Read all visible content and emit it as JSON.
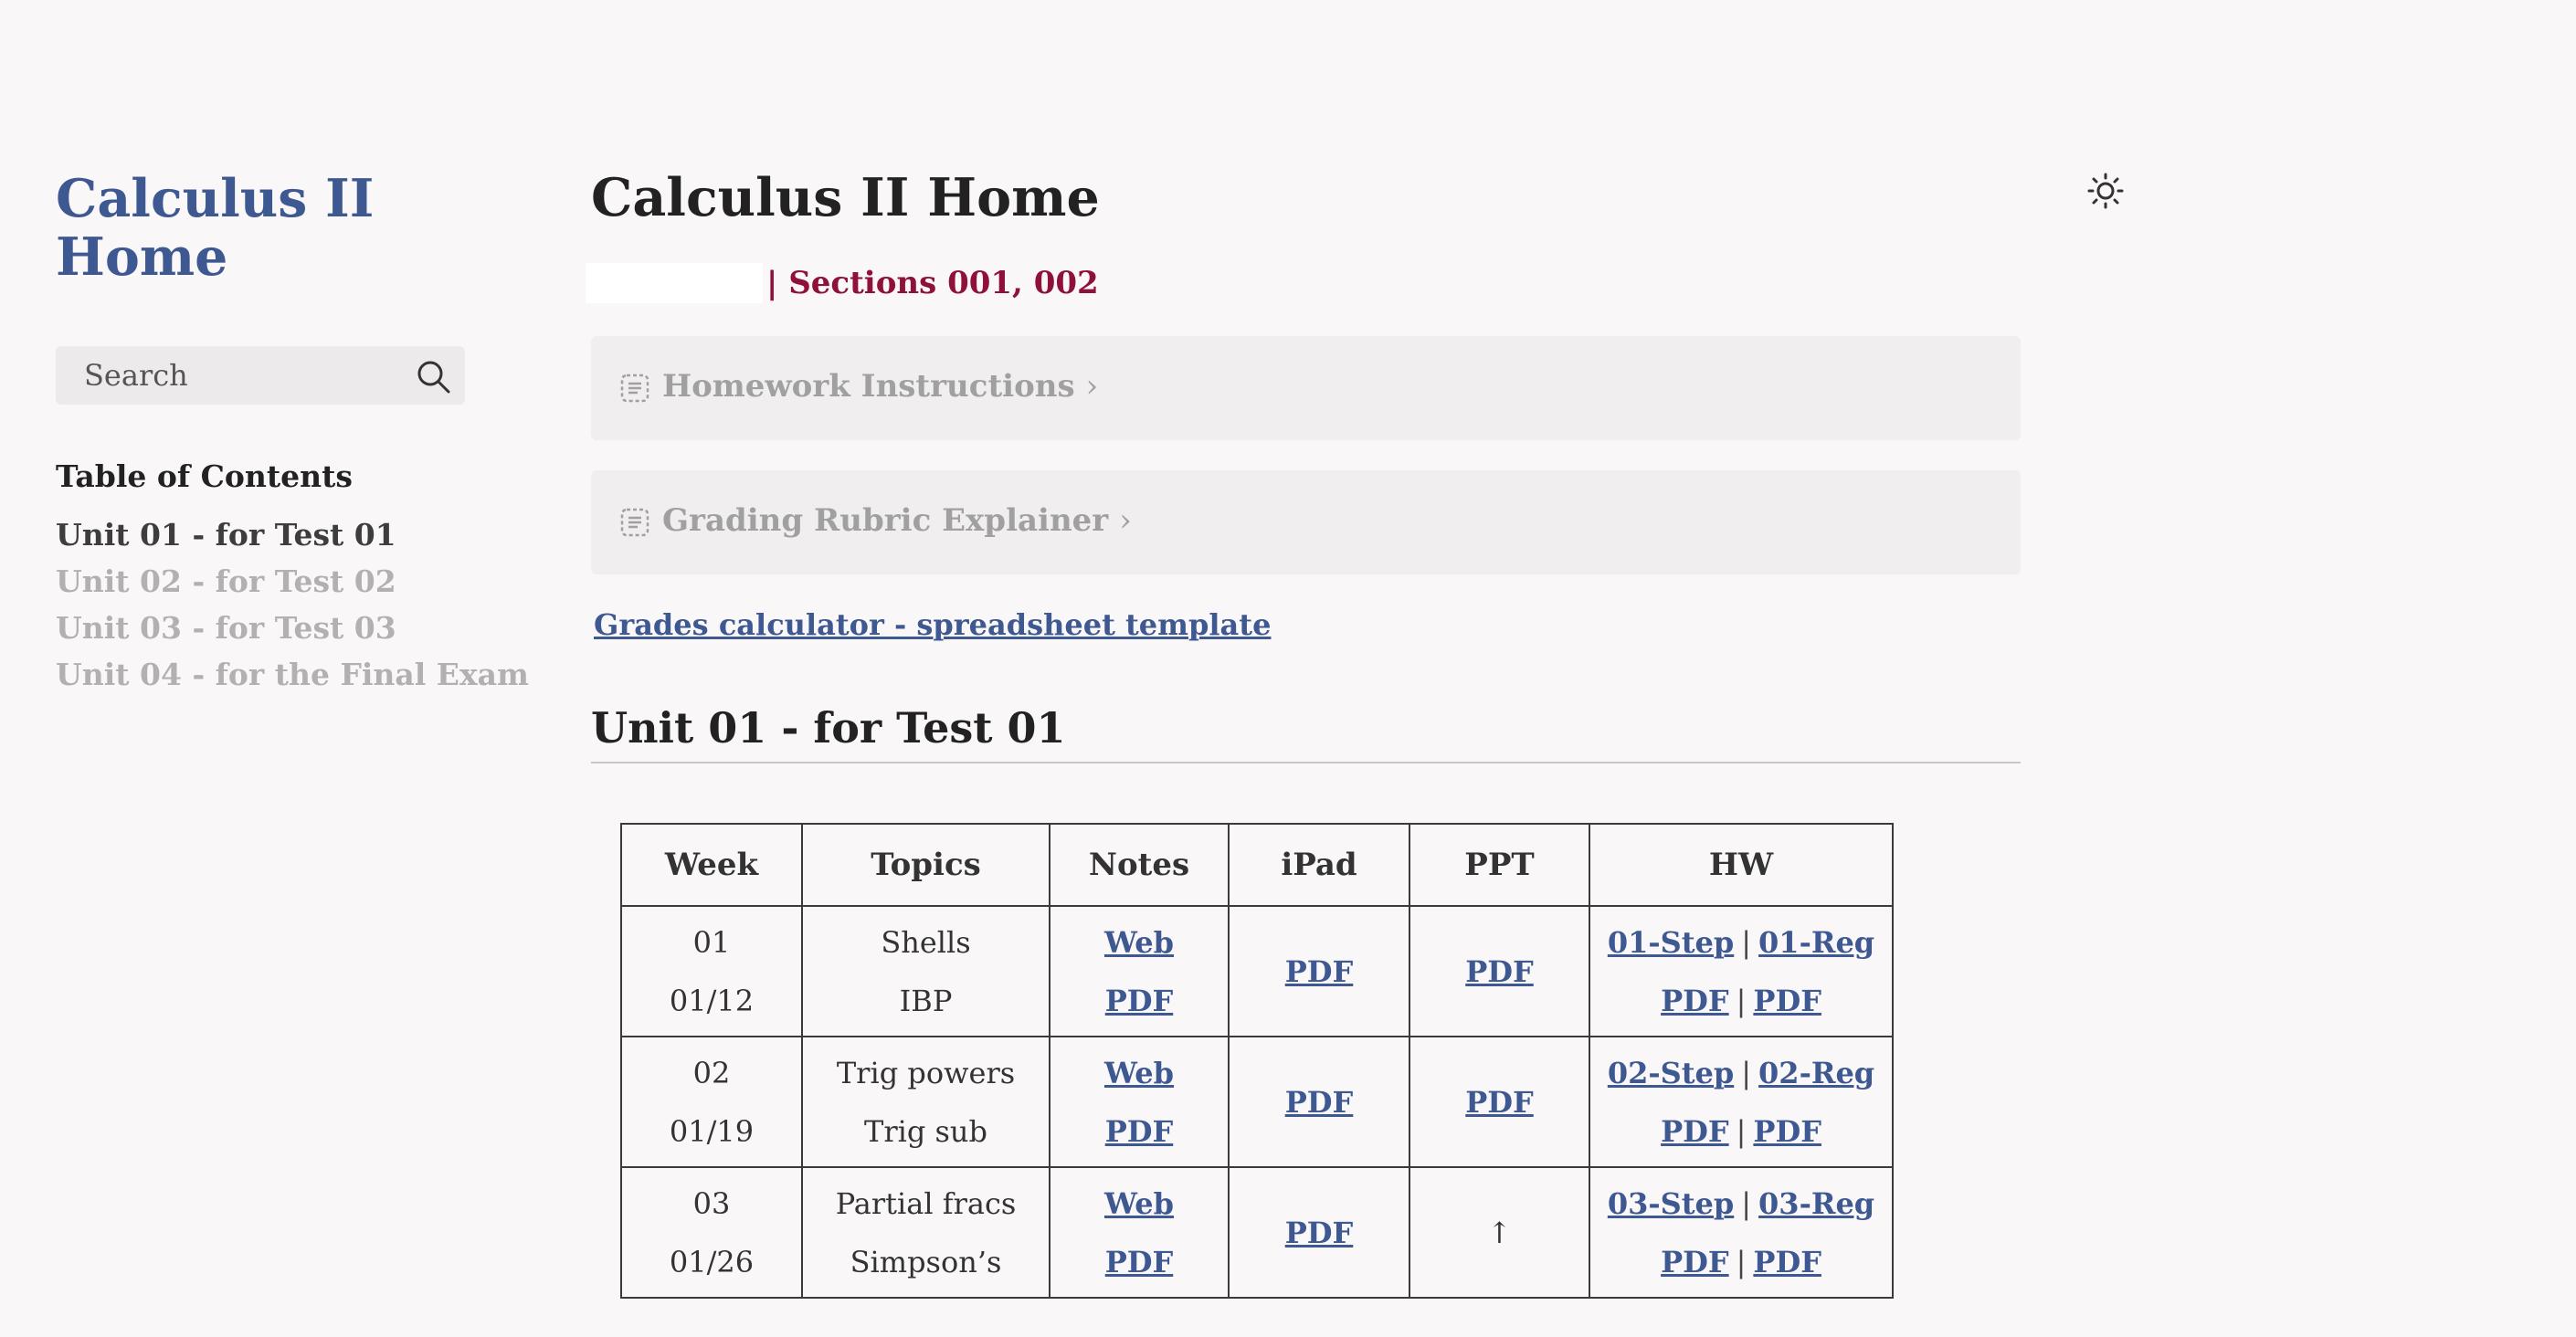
{
  "sidebar": {
    "site_title": "Calculus II Home",
    "search_placeholder": "Search",
    "toc_title": "Table of Contents",
    "toc_items": [
      {
        "label": "Unit 01 - for Test 01",
        "active": true
      },
      {
        "label": "Unit 02 - for Test 02",
        "active": false
      },
      {
        "label": "Unit 03 - for Test 03",
        "active": false
      },
      {
        "label": "Unit 04 - for the Final Exam",
        "active": false
      }
    ]
  },
  "header": {
    "title": "Calculus II Home",
    "subtitle": "| Sections 001, 002",
    "theme_icon": "sun-icon"
  },
  "admonitions": [
    {
      "label": "Homework Instructions",
      "icon": "document-icon"
    },
    {
      "label": "Grading Rubric Explainer",
      "icon": "document-icon"
    }
  ],
  "grades_link": "Grades calculator - spreadsheet template",
  "unit": {
    "heading": "Unit 01 - for Test 01",
    "columns": [
      "Week",
      "Topics",
      "Notes",
      "iPad",
      "PPT",
      "HW"
    ],
    "rows": [
      {
        "week": "01",
        "date": "01/12",
        "topic1": "Shells",
        "topic2": "IBP",
        "notes_web": "Web",
        "notes_pdf": "PDF",
        "ipad": "PDF",
        "ppt": "PDF",
        "hw_step": "01-Step",
        "hw_reg": "01-Reg",
        "hw_pdf1": "PDF",
        "hw_pdf2": "PDF"
      },
      {
        "week": "02",
        "date": "01/19",
        "topic1": "Trig powers",
        "topic2": "Trig sub",
        "notes_web": "Web",
        "notes_pdf": "PDF",
        "ipad": "PDF",
        "ppt": "PDF",
        "hw_step": "02-Step",
        "hw_reg": "02-Reg",
        "hw_pdf1": "PDF",
        "hw_pdf2": "PDF"
      },
      {
        "week": "03",
        "date": "01/26",
        "topic1": "Partial fracs",
        "topic2": "Simpson’s",
        "notes_web": "Web",
        "notes_pdf": "PDF",
        "ipad": "PDF",
        "ppt": "↑",
        "hw_step": "03-Step",
        "hw_reg": "03-Reg",
        "hw_pdf1": "PDF",
        "hw_pdf2": "PDF"
      }
    ],
    "hw_separator": "|"
  }
}
